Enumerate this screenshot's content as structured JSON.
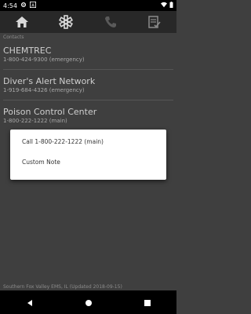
{
  "status_bar": {
    "time": "4:54",
    "icons": [
      "gear-icon",
      "a-notification-icon",
      "wifi-icon",
      "battery-icon"
    ]
  },
  "toolbar": {
    "buttons": [
      "home-icon",
      "star-of-life-icon",
      "phone-icon",
      "checklist-icon"
    ]
  },
  "main": {
    "section_label": "Contacts",
    "contacts": [
      {
        "name": "CHEMTREC",
        "phone": "1-800-424-9300 (emergency)"
      },
      {
        "name": "Diver's Alert Network",
        "phone": "1-919-684-4326 (emergency)"
      },
      {
        "name": "Poison Control Center",
        "phone": "1-800-222-1222 (main)"
      }
    ]
  },
  "footer": {
    "text": "Southern Fox Valley EMS, IL (Updated 2018-09-15)"
  },
  "dialog": {
    "items": [
      "Call 1-800-222-1222 (main)",
      "Custom Note"
    ]
  },
  "nav": {
    "buttons": [
      "back-icon",
      "home-circle-icon",
      "recents-icon"
    ]
  }
}
